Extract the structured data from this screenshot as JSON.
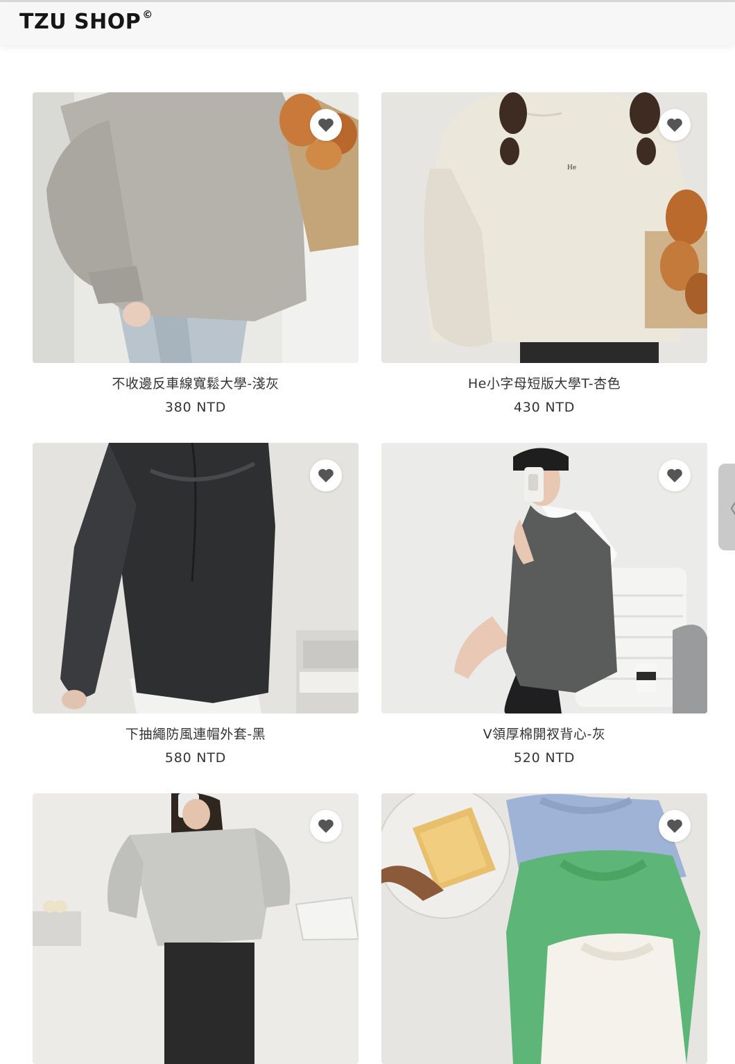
{
  "header": {
    "brand": "TZU SHOP",
    "brand_mark": "©"
  },
  "products": [
    {
      "title": "不收邊反車線寬鬆大學-淺灰",
      "price": "380 NTD"
    },
    {
      "title": "He小字母短版大學T-杏色",
      "price": "430 NTD"
    },
    {
      "title": "下抽繩防風連帽外套-黑",
      "price": "580 NTD"
    },
    {
      "title": "V領厚棉開衩背心-灰",
      "price": "520 NTD"
    },
    {
      "title": "",
      "price": ""
    },
    {
      "title": "",
      "price": ""
    }
  ],
  "icons": {
    "favorite": "heart-icon",
    "side_tab": "chevron-left-icon"
  },
  "side_tab": {
    "glyph": "〈"
  },
  "colors": {
    "header_bg": "#f7f7f7",
    "text": "#333333",
    "heart": "#555555"
  }
}
